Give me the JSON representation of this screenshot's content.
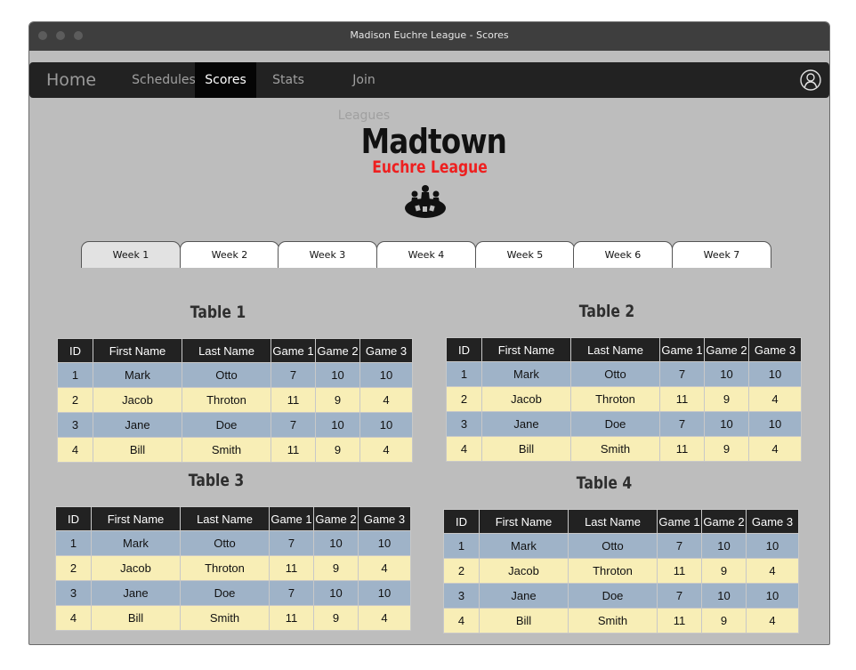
{
  "window": {
    "title": "Madison Euchre League - Scores"
  },
  "nav": {
    "home": "Home",
    "items": [
      "Schedules",
      "Scores",
      "Stats",
      "Join Leagues"
    ],
    "active_index": 1
  },
  "logo": {
    "main": "Madtown",
    "sub": "Euchre League"
  },
  "weeks": [
    "Week 1",
    "Week 2",
    "Week 3",
    "Week 4",
    "Week 5",
    "Week 6",
    "Week 7"
  ],
  "active_week_index": 0,
  "columns": [
    "ID",
    "First Name",
    "Last Name",
    "Game 1",
    "Game 2",
    "Game 3"
  ],
  "tables": [
    {
      "title": "Table 1",
      "rows": [
        [
          "1",
          "Mark",
          "Otto",
          "7",
          "10",
          "10"
        ],
        [
          "2",
          "Jacob",
          "Throton",
          "11",
          "9",
          "4"
        ],
        [
          "3",
          "Jane",
          "Doe",
          "7",
          "10",
          "10"
        ],
        [
          "4",
          "Bill",
          "Smith",
          "11",
          "9",
          "4"
        ]
      ]
    },
    {
      "title": "Table 2",
      "rows": [
        [
          "1",
          "Mark",
          "Otto",
          "7",
          "10",
          "10"
        ],
        [
          "2",
          "Jacob",
          "Throton",
          "11",
          "9",
          "4"
        ],
        [
          "3",
          "Jane",
          "Doe",
          "7",
          "10",
          "10"
        ],
        [
          "4",
          "Bill",
          "Smith",
          "11",
          "9",
          "4"
        ]
      ]
    },
    {
      "title": "Table 3",
      "rows": [
        [
          "1",
          "Mark",
          "Otto",
          "7",
          "10",
          "10"
        ],
        [
          "2",
          "Jacob",
          "Throton",
          "11",
          "9",
          "4"
        ],
        [
          "3",
          "Jane",
          "Doe",
          "7",
          "10",
          "10"
        ],
        [
          "4",
          "Bill",
          "Smith",
          "11",
          "9",
          "4"
        ]
      ]
    },
    {
      "title": "Table 4",
      "rows": [
        [
          "1",
          "Mark",
          "Otto",
          "7",
          "10",
          "10"
        ],
        [
          "2",
          "Jacob",
          "Throton",
          "11",
          "9",
          "4"
        ],
        [
          "3",
          "Jane",
          "Doe",
          "7",
          "10",
          "10"
        ],
        [
          "4",
          "Bill",
          "Smith",
          "11",
          "9",
          "4"
        ]
      ]
    }
  ],
  "colors": {
    "row_odd": "#9fb3c8",
    "row_even": "#f8eeb6",
    "header": "#222222",
    "brand_red": "#ee2020"
  }
}
